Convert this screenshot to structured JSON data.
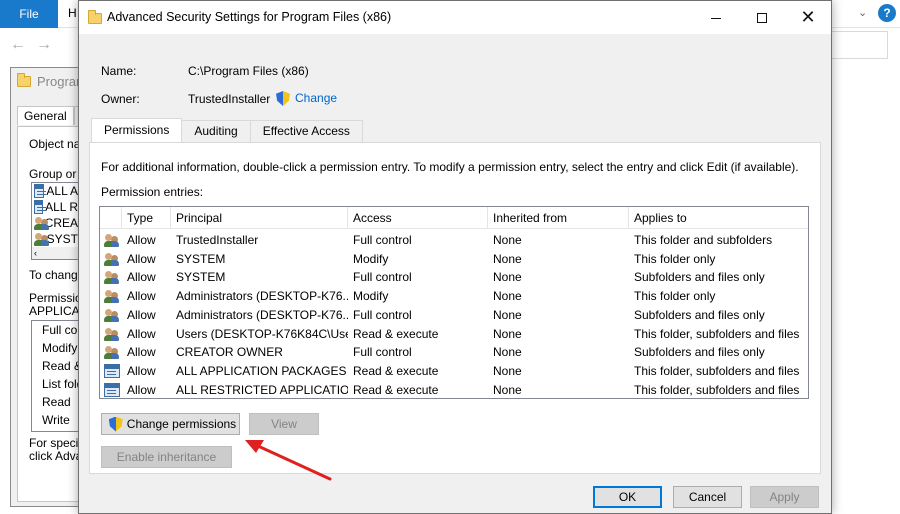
{
  "background_explorer": {
    "file_tab": "File",
    "home_tab_partial": "H"
  },
  "properties_dialog": {
    "title_partial": "Progran",
    "tabs": [
      "General",
      "S"
    ],
    "object_name_partial": "Object nar",
    "group_partial": "Group or u",
    "groups": [
      "ALL A",
      "ALL R",
      "CREA",
      "SYST"
    ],
    "to_change_partial": "To change",
    "permission_partial": "Permission",
    "applic_partial": "APPLICAT",
    "permissions": [
      "Full con",
      "Modify",
      "Read &",
      "List folde",
      "Read",
      "Write"
    ],
    "special_partial_1": "For specia",
    "special_partial_2": "click Adva"
  },
  "dialog": {
    "title": "Advanced Security Settings for Program Files (x86)",
    "name_label": "Name:",
    "name_value": "C:\\Program Files (x86)",
    "owner_label": "Owner:",
    "owner_value": "TrustedInstaller",
    "change_link": "Change",
    "tabs": [
      "Permissions",
      "Auditing",
      "Effective Access"
    ],
    "active_tab": "Permissions",
    "info_text": "For additional information, double-click a permission entry. To modify a permission entry, select the entry and click Edit (if available).",
    "entries_label": "Permission entries:",
    "columns": [
      "Type",
      "Principal",
      "Access",
      "Inherited from",
      "Applies to"
    ],
    "rows": [
      {
        "icon": "users-icon",
        "type": "Allow",
        "principal": "TrustedInstaller",
        "access": "Full control",
        "inherited": "None",
        "applies": "This folder and subfolders"
      },
      {
        "icon": "users-icon",
        "type": "Allow",
        "principal": "SYSTEM",
        "access": "Modify",
        "inherited": "None",
        "applies": "This folder only"
      },
      {
        "icon": "users-icon",
        "type": "Allow",
        "principal": "SYSTEM",
        "access": "Full control",
        "inherited": "None",
        "applies": "Subfolders and files only"
      },
      {
        "icon": "users-icon",
        "type": "Allow",
        "principal": "Administrators (DESKTOP-K76...",
        "access": "Modify",
        "inherited": "None",
        "applies": "This folder only"
      },
      {
        "icon": "users-icon",
        "type": "Allow",
        "principal": "Administrators (DESKTOP-K76...",
        "access": "Full control",
        "inherited": "None",
        "applies": "Subfolders and files only"
      },
      {
        "icon": "users-icon",
        "type": "Allow",
        "principal": "Users (DESKTOP-K76K84C\\Use...",
        "access": "Read & execute",
        "inherited": "None",
        "applies": "This folder, subfolders and files"
      },
      {
        "icon": "users-icon",
        "type": "Allow",
        "principal": "CREATOR OWNER",
        "access": "Full control",
        "inherited": "None",
        "applies": "Subfolders and files only"
      },
      {
        "icon": "app-package-icon",
        "type": "Allow",
        "principal": "ALL APPLICATION PACKAGES",
        "access": "Read & execute",
        "inherited": "None",
        "applies": "This folder, subfolders and files"
      },
      {
        "icon": "app-package-icon",
        "type": "Allow",
        "principal": "ALL RESTRICTED APPLICATIO...",
        "access": "Read & execute",
        "inherited": "None",
        "applies": "This folder, subfolders and files"
      }
    ],
    "buttons": {
      "change_permissions": "Change permissions",
      "view": "View",
      "enable_inheritance": "Enable inheritance",
      "ok": "OK",
      "cancel": "Cancel",
      "apply": "Apply"
    }
  },
  "colors": {
    "accent_blue": "#1979ca",
    "link_blue": "#0066cc",
    "arrow_red": "#e02020",
    "focus_border": "#0078d7"
  }
}
